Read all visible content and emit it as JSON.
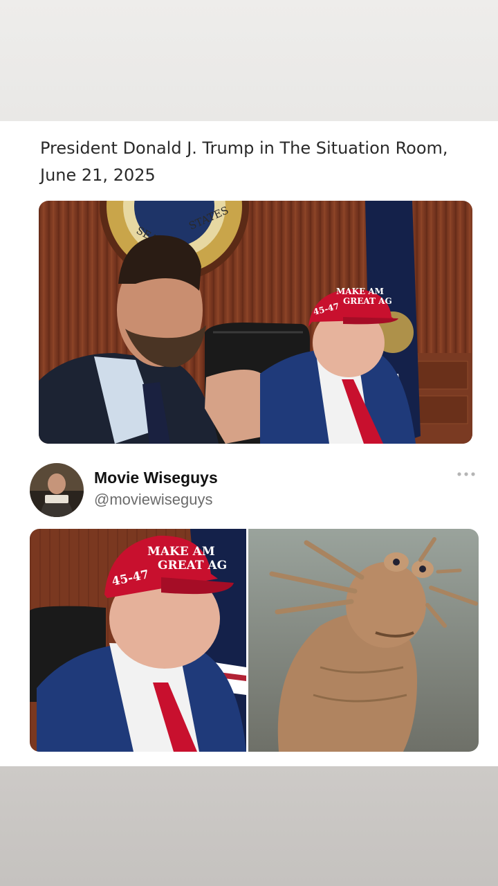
{
  "post": {
    "text": "President Donald J. Trump in The Situation Room, June 21, 2025"
  },
  "photo1": {
    "seal_text_left": "SEAL",
    "seal_text_right": "STATES",
    "hat_line1": "MAKE AM",
    "hat_line2": "GREAT AG",
    "hat_side": "45-47"
  },
  "author": {
    "name": "Movie Wiseguys",
    "handle": "@moviewiseguys",
    "more_icon": "more-horizontal-icon"
  },
  "photo2": {
    "hat_line1": "MAKE AM",
    "hat_line2": "GREAT AG",
    "hat_side": "45-47"
  },
  "colors": {
    "card_bg": "#ffffff",
    "text": "#2a2a2a",
    "handle": "#6b6b6b",
    "hat_red": "#c8102e",
    "suit_blue": "#1f3a7a"
  }
}
